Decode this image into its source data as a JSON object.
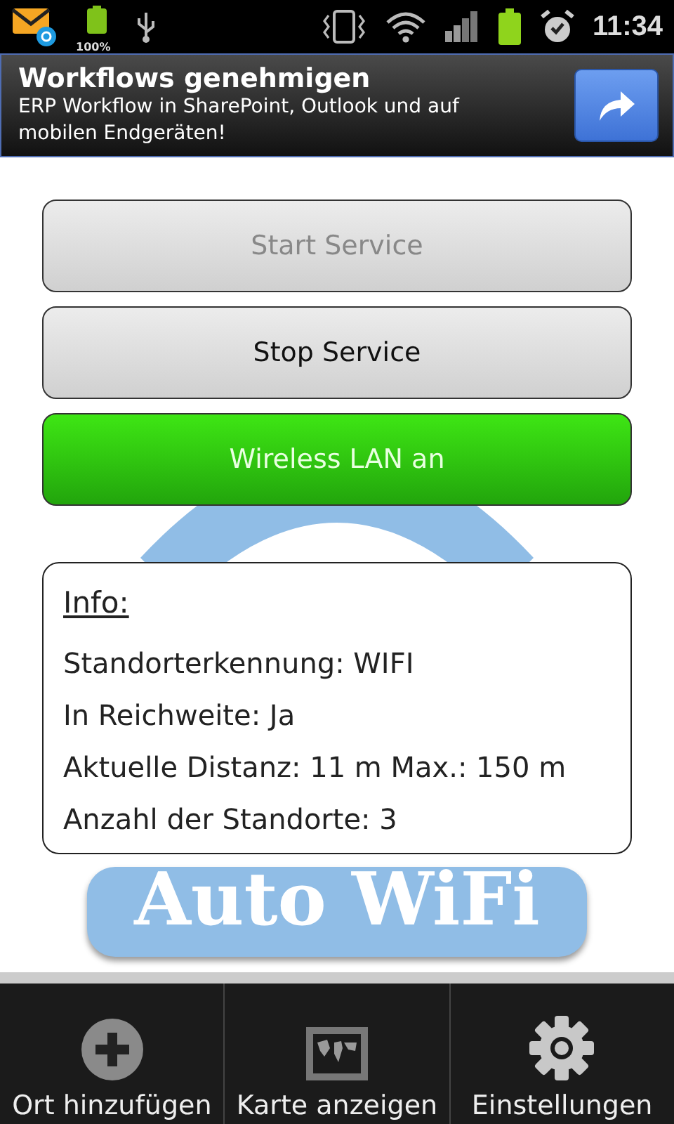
{
  "status_bar": {
    "battery_label": "100%",
    "time": "11:34"
  },
  "ad": {
    "title": "Workflows genehmigen",
    "text": "ERP Workflow in SharePoint, Outlook und auf mobilen Endgeräten!"
  },
  "buttons": [
    {
      "label": "Start Service",
      "kind": "plain",
      "disabled": true
    },
    {
      "label": "Stop Service",
      "kind": "plain",
      "disabled": false
    },
    {
      "label": "Wireless LAN an",
      "kind": "toggle",
      "on": true
    }
  ],
  "logo": {
    "text": "Auto WiFi"
  },
  "info": {
    "title": "Info:",
    "lines": [
      "Standorterkennung: WIFI",
      "In Reichweite: Ja",
      "Aktuelle Distanz: 11 m Max.: 150 m",
      "Anzahl der Standorte: 3"
    ]
  },
  "bottom_bar": [
    {
      "label": "Ort hinzufügen",
      "kind": "add"
    },
    {
      "label": "Karte anzeigen",
      "kind": "map"
    },
    {
      "label": "Einstellungen",
      "kind": "settings"
    }
  ]
}
